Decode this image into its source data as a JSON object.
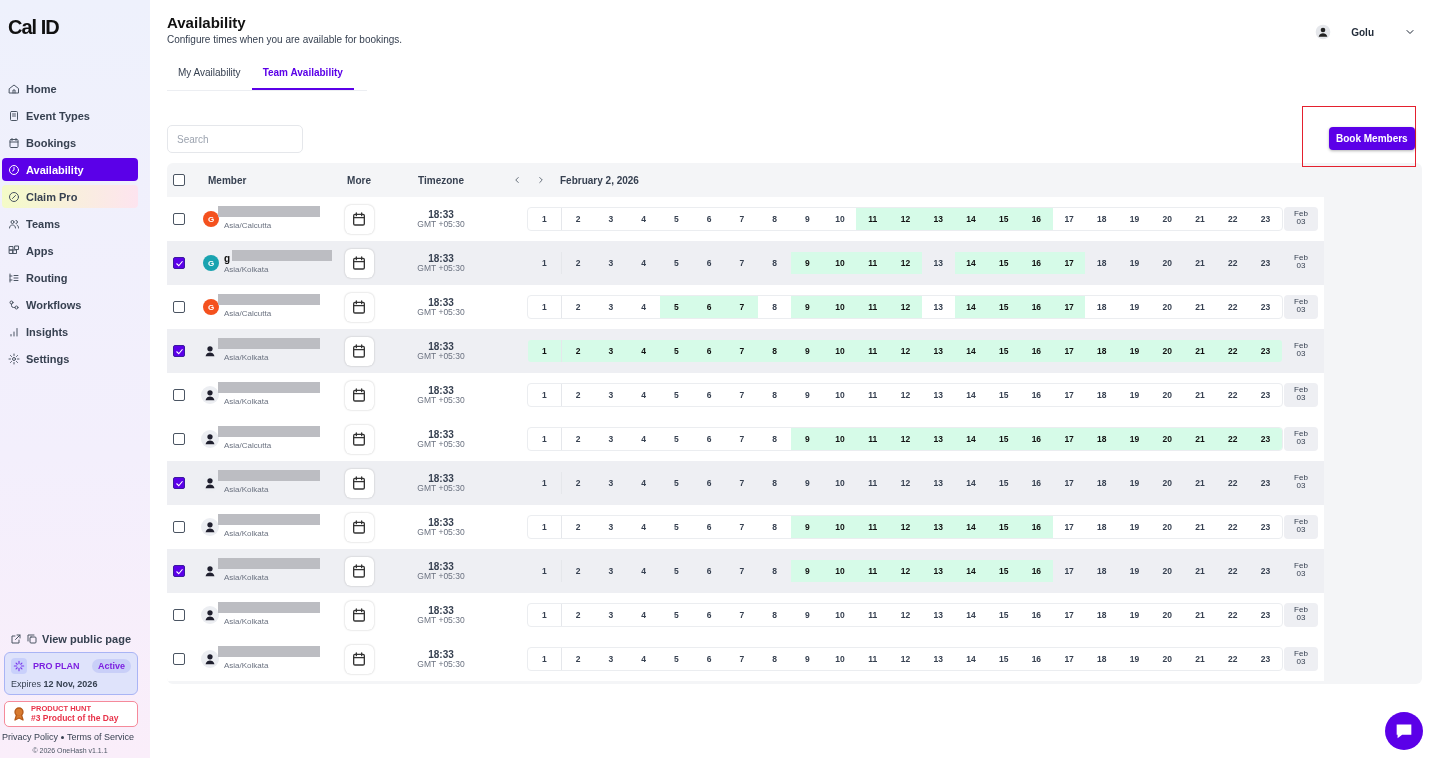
{
  "sidebar": {
    "logo": "Cal ID",
    "items": [
      {
        "label": "Home",
        "kind": "nav",
        "selected": false
      },
      {
        "label": "Event Types",
        "kind": "nav",
        "selected": false
      },
      {
        "label": "Bookings",
        "kind": "nav",
        "selected": false
      },
      {
        "label": "Availability",
        "kind": "nav",
        "selected": true
      },
      {
        "label": "Claim Pro",
        "kind": "promo",
        "selected": false
      },
      {
        "label": "Teams",
        "kind": "nav",
        "selected": false
      },
      {
        "label": "Apps",
        "kind": "nav",
        "selected": false
      },
      {
        "label": "Routing",
        "kind": "nav",
        "selected": false
      },
      {
        "label": "Workflows",
        "kind": "nav",
        "selected": false
      },
      {
        "label": "Insights",
        "kind": "nav",
        "selected": false
      },
      {
        "label": "Settings",
        "kind": "nav",
        "selected": false
      }
    ],
    "public_page": "View public page",
    "plan": {
      "name": "PRO PLAN",
      "badge": "Active",
      "expires_label": "Expires",
      "expires_date": "12 Nov, 2026"
    },
    "product_hunt": {
      "overline": "PRODUCT HUNT",
      "title": "#3 Product of the Day"
    },
    "footer_links": [
      "Privacy Policy",
      "Terms of Service"
    ],
    "copyright": "© 2026 OneHash v1.1.1"
  },
  "header": {
    "title": "Availability",
    "subtitle": "Configure times when you are available for bookings.",
    "user": "Golu"
  },
  "tabs": [
    {
      "label": "My Availability",
      "selected": false
    },
    {
      "label": "Team Availability",
      "selected": true
    }
  ],
  "search": {
    "placeholder": "Search"
  },
  "book_button": {
    "label": "Book Members",
    "highlighted": true
  },
  "table": {
    "columns": [
      "Member",
      "More",
      "Timezone"
    ],
    "date": "February 2, 2026",
    "all_checked": false,
    "rows": [
      {
        "checked": false,
        "avatar": {
          "kind": "letter",
          "letter": "G",
          "color": "#f4511e"
        },
        "redacted": true,
        "tz": "Asia/Calcutta",
        "time": "18:33",
        "offset": "GMT +05:30",
        "next": "Feb 03",
        "slots": [
          {
            "label": "1",
            "available": false
          },
          {
            "label": "2",
            "available": false
          },
          {
            "label": "3",
            "available": false
          },
          {
            "label": "4",
            "available": false
          },
          {
            "label": "5",
            "available": false
          },
          {
            "label": "6",
            "available": false
          },
          {
            "label": "7",
            "available": false
          },
          {
            "label": "8",
            "available": false
          },
          {
            "label": "9",
            "available": false
          },
          {
            "label": "10",
            "available": false
          },
          {
            "label": "11",
            "available": true
          },
          {
            "label": "12",
            "available": true
          },
          {
            "label": "13",
            "available": true
          },
          {
            "label": "14",
            "available": true
          },
          {
            "label": "15",
            "available": true
          },
          {
            "label": "16",
            "available": true
          },
          {
            "label": "17",
            "available": false
          },
          {
            "label": "18",
            "available": false
          },
          {
            "label": "19",
            "available": false
          },
          {
            "label": "20",
            "available": false
          },
          {
            "label": "21",
            "available": false
          },
          {
            "label": "22",
            "available": false
          },
          {
            "label": "23",
            "available": false
          }
        ]
      },
      {
        "checked": true,
        "avatar": {
          "kind": "letter",
          "letter": "G",
          "color": "#1aa3b0"
        },
        "name": "g",
        "redacted": true,
        "tz": "Asia/Kolkata",
        "time": "18:33",
        "offset": "GMT +05:30",
        "next": "Feb 03",
        "slots": [
          {
            "label": "1",
            "available": false
          },
          {
            "label": "2",
            "available": false
          },
          {
            "label": "3",
            "available": false
          },
          {
            "label": "4",
            "available": false
          },
          {
            "label": "5",
            "available": false
          },
          {
            "label": "6",
            "available": false
          },
          {
            "label": "7",
            "available": false
          },
          {
            "label": "8",
            "available": false
          },
          {
            "label": "9",
            "available": true
          },
          {
            "label": "10",
            "available": true
          },
          {
            "label": "11",
            "available": true
          },
          {
            "label": "12",
            "available": true
          },
          {
            "label": "13",
            "available": false
          },
          {
            "label": "14",
            "available": true
          },
          {
            "label": "15",
            "available": true
          },
          {
            "label": "16",
            "available": true
          },
          {
            "label": "17",
            "available": true
          },
          {
            "label": "18",
            "available": false
          },
          {
            "label": "19",
            "available": false
          },
          {
            "label": "20",
            "available": false
          },
          {
            "label": "21",
            "available": false
          },
          {
            "label": "22",
            "available": false
          },
          {
            "label": "23",
            "available": false
          }
        ]
      },
      {
        "checked": false,
        "avatar": {
          "kind": "letter",
          "letter": "G",
          "color": "#f4511e"
        },
        "redacted": true,
        "tz": "Asia/Calcutta",
        "time": "18:33",
        "offset": "GMT +05:30",
        "next": "Feb 03",
        "slots": [
          {
            "label": "1",
            "available": false
          },
          {
            "label": "2",
            "available": false
          },
          {
            "label": "3",
            "available": false
          },
          {
            "label": "4",
            "available": false
          },
          {
            "label": "5",
            "available": true
          },
          {
            "label": "6",
            "available": true
          },
          {
            "label": "7",
            "available": true
          },
          {
            "label": "8",
            "available": false
          },
          {
            "label": "9",
            "available": true
          },
          {
            "label": "10",
            "available": true
          },
          {
            "label": "11",
            "available": true
          },
          {
            "label": "12",
            "available": true
          },
          {
            "label": "13",
            "available": false
          },
          {
            "label": "14",
            "available": true
          },
          {
            "label": "15",
            "available": true
          },
          {
            "label": "16",
            "available": true
          },
          {
            "label": "17",
            "available": true
          },
          {
            "label": "18",
            "available": false
          },
          {
            "label": "19",
            "available": false
          },
          {
            "label": "20",
            "available": false
          },
          {
            "label": "21",
            "available": false
          },
          {
            "label": "22",
            "available": false
          },
          {
            "label": "23",
            "available": false
          }
        ]
      },
      {
        "checked": true,
        "avatar": {
          "kind": "person"
        },
        "redacted": true,
        "tz": "Asia/Kolkata",
        "time": "18:33",
        "offset": "GMT +05:30",
        "next": "Feb 03",
        "slots": [
          {
            "label": "1",
            "available": true
          },
          {
            "label": "2",
            "available": true
          },
          {
            "label": "3",
            "available": true
          },
          {
            "label": "4",
            "available": true
          },
          {
            "label": "5",
            "available": true
          },
          {
            "label": "6",
            "available": true
          },
          {
            "label": "7",
            "available": true
          },
          {
            "label": "8",
            "available": true
          },
          {
            "label": "9",
            "available": true
          },
          {
            "label": "10",
            "available": true
          },
          {
            "label": "11",
            "available": true
          },
          {
            "label": "12",
            "available": true
          },
          {
            "label": "13",
            "available": true
          },
          {
            "label": "14",
            "available": true
          },
          {
            "label": "15",
            "available": true
          },
          {
            "label": "16",
            "available": true
          },
          {
            "label": "17",
            "available": true
          },
          {
            "label": "18",
            "available": true
          },
          {
            "label": "19",
            "available": true
          },
          {
            "label": "20",
            "available": true
          },
          {
            "label": "21",
            "available": true
          },
          {
            "label": "22",
            "available": true
          },
          {
            "label": "23",
            "available": true
          }
        ]
      },
      {
        "checked": false,
        "avatar": {
          "kind": "person"
        },
        "redacted": true,
        "tz": "Asia/Kolkata",
        "time": "18:33",
        "offset": "GMT +05:30",
        "next": "Feb 03",
        "slots": [
          {
            "label": "1",
            "available": false
          },
          {
            "label": "2",
            "available": false
          },
          {
            "label": "3",
            "available": false
          },
          {
            "label": "4",
            "available": false
          },
          {
            "label": "5",
            "available": false
          },
          {
            "label": "6",
            "available": false
          },
          {
            "label": "7",
            "available": false
          },
          {
            "label": "8",
            "available": false
          },
          {
            "label": "9",
            "available": false
          },
          {
            "label": "10",
            "available": false
          },
          {
            "label": "11",
            "available": false
          },
          {
            "label": "12",
            "available": false
          },
          {
            "label": "13",
            "available": false
          },
          {
            "label": "14",
            "available": false
          },
          {
            "label": "15",
            "available": false
          },
          {
            "label": "16",
            "available": false
          },
          {
            "label": "17",
            "available": false
          },
          {
            "label": "18",
            "available": false
          },
          {
            "label": "19",
            "available": false
          },
          {
            "label": "20",
            "available": false
          },
          {
            "label": "21",
            "available": false
          },
          {
            "label": "22",
            "available": false
          },
          {
            "label": "23",
            "available": false
          }
        ]
      },
      {
        "checked": false,
        "avatar": {
          "kind": "person"
        },
        "redacted": true,
        "tz": "Asia/Calcutta",
        "time": "18:33",
        "offset": "GMT +05:30",
        "next": "Feb 03",
        "slots": [
          {
            "label": "1",
            "available": false
          },
          {
            "label": "2",
            "available": false
          },
          {
            "label": "3",
            "available": false
          },
          {
            "label": "4",
            "available": false
          },
          {
            "label": "5",
            "available": false
          },
          {
            "label": "6",
            "available": false
          },
          {
            "label": "7",
            "available": false
          },
          {
            "label": "8",
            "available": false
          },
          {
            "label": "9",
            "available": true
          },
          {
            "label": "10",
            "available": true
          },
          {
            "label": "11",
            "available": true
          },
          {
            "label": "12",
            "available": true
          },
          {
            "label": "13",
            "available": true
          },
          {
            "label": "14",
            "available": true
          },
          {
            "label": "15",
            "available": true
          },
          {
            "label": "16",
            "available": true
          },
          {
            "label": "17",
            "available": true
          },
          {
            "label": "18",
            "available": true
          },
          {
            "label": "19",
            "available": true
          },
          {
            "label": "20",
            "available": true
          },
          {
            "label": "21",
            "available": true
          },
          {
            "label": "22",
            "available": true
          },
          {
            "label": "23",
            "available": true
          }
        ]
      },
      {
        "checked": true,
        "avatar": {
          "kind": "person"
        },
        "redacted": true,
        "tz": "Asia/Kolkata",
        "time": "18:33",
        "offset": "GMT +05:30",
        "next": "Feb 03",
        "slots": [
          {
            "label": "1",
            "available": false
          },
          {
            "label": "2",
            "available": false
          },
          {
            "label": "3",
            "available": false
          },
          {
            "label": "4",
            "available": false
          },
          {
            "label": "5",
            "available": false
          },
          {
            "label": "6",
            "available": false
          },
          {
            "label": "7",
            "available": false
          },
          {
            "label": "8",
            "available": false
          },
          {
            "label": "9",
            "available": false
          },
          {
            "label": "10",
            "available": false
          },
          {
            "label": "11",
            "available": false
          },
          {
            "label": "12",
            "available": false
          },
          {
            "label": "13",
            "available": false
          },
          {
            "label": "14",
            "available": false
          },
          {
            "label": "15",
            "available": false
          },
          {
            "label": "16",
            "available": false
          },
          {
            "label": "17",
            "available": false
          },
          {
            "label": "18",
            "available": false
          },
          {
            "label": "19",
            "available": false
          },
          {
            "label": "20",
            "available": false
          },
          {
            "label": "21",
            "available": false
          },
          {
            "label": "22",
            "available": false
          },
          {
            "label": "23",
            "available": false
          }
        ]
      },
      {
        "checked": false,
        "avatar": {
          "kind": "person"
        },
        "redacted": true,
        "tz": "Asia/Kolkata",
        "time": "18:33",
        "offset": "GMT +05:30",
        "next": "Feb 03",
        "slots": [
          {
            "label": "1",
            "available": false
          },
          {
            "label": "2",
            "available": false
          },
          {
            "label": "3",
            "available": false
          },
          {
            "label": "4",
            "available": false
          },
          {
            "label": "5",
            "available": false
          },
          {
            "label": "6",
            "available": false
          },
          {
            "label": "7",
            "available": false
          },
          {
            "label": "8",
            "available": false
          },
          {
            "label": "9",
            "available": true
          },
          {
            "label": "10",
            "available": true
          },
          {
            "label": "11",
            "available": true
          },
          {
            "label": "12",
            "available": true
          },
          {
            "label": "13",
            "available": true
          },
          {
            "label": "14",
            "available": true
          },
          {
            "label": "15",
            "available": true
          },
          {
            "label": "16",
            "available": true
          },
          {
            "label": "17",
            "available": false
          },
          {
            "label": "18",
            "available": false
          },
          {
            "label": "19",
            "available": false
          },
          {
            "label": "20",
            "available": false
          },
          {
            "label": "21",
            "available": false
          },
          {
            "label": "22",
            "available": false
          },
          {
            "label": "23",
            "available": false
          }
        ]
      },
      {
        "checked": true,
        "avatar": {
          "kind": "person"
        },
        "redacted": true,
        "tz": "Asia/Kolkata",
        "time": "18:33",
        "offset": "GMT +05:30",
        "next": "Feb 03",
        "slots": [
          {
            "label": "1",
            "available": false
          },
          {
            "label": "2",
            "available": false
          },
          {
            "label": "3",
            "available": false
          },
          {
            "label": "4",
            "available": false
          },
          {
            "label": "5",
            "available": false
          },
          {
            "label": "6",
            "available": false
          },
          {
            "label": "7",
            "available": false
          },
          {
            "label": "8",
            "available": false
          },
          {
            "label": "9",
            "available": true
          },
          {
            "label": "10",
            "available": true
          },
          {
            "label": "11",
            "available": true
          },
          {
            "label": "12",
            "available": true
          },
          {
            "label": "13",
            "available": true
          },
          {
            "label": "14",
            "available": true
          },
          {
            "label": "15",
            "available": true
          },
          {
            "label": "16",
            "available": true
          },
          {
            "label": "17",
            "available": false
          },
          {
            "label": "18",
            "available": false
          },
          {
            "label": "19",
            "available": false
          },
          {
            "label": "20",
            "available": false
          },
          {
            "label": "21",
            "available": false
          },
          {
            "label": "22",
            "available": false
          },
          {
            "label": "23",
            "available": false
          }
        ]
      },
      {
        "checked": false,
        "avatar": {
          "kind": "person"
        },
        "redacted": true,
        "tz": "Asia/Kolkata",
        "time": "18:33",
        "offset": "GMT +05:30",
        "next": "Feb 03",
        "slots": [
          {
            "label": "1",
            "available": false
          },
          {
            "label": "2",
            "available": false
          },
          {
            "label": "3",
            "available": false
          },
          {
            "label": "4",
            "available": false
          },
          {
            "label": "5",
            "available": false
          },
          {
            "label": "6",
            "available": false
          },
          {
            "label": "7",
            "available": false
          },
          {
            "label": "8",
            "available": false
          },
          {
            "label": "9",
            "available": false
          },
          {
            "label": "10",
            "available": false
          },
          {
            "label": "11",
            "available": false
          },
          {
            "label": "12",
            "available": false
          },
          {
            "label": "13",
            "available": false
          },
          {
            "label": "14",
            "available": false
          },
          {
            "label": "15",
            "available": false
          },
          {
            "label": "16",
            "available": false
          },
          {
            "label": "17",
            "available": false
          },
          {
            "label": "18",
            "available": false
          },
          {
            "label": "19",
            "available": false
          },
          {
            "label": "20",
            "available": false
          },
          {
            "label": "21",
            "available": false
          },
          {
            "label": "22",
            "available": false
          },
          {
            "label": "23",
            "available": false
          }
        ]
      },
      {
        "checked": false,
        "avatar": {
          "kind": "person"
        },
        "redacted": true,
        "tz": "Asia/Kolkata",
        "time": "18:33",
        "offset": "GMT +05:30",
        "next": "Feb 03",
        "slots": [
          {
            "label": "1",
            "available": false
          },
          {
            "label": "2",
            "available": false
          },
          {
            "label": "3",
            "available": false
          },
          {
            "label": "4",
            "available": false
          },
          {
            "label": "5",
            "available": false
          },
          {
            "label": "6",
            "available": false
          },
          {
            "label": "7",
            "available": false
          },
          {
            "label": "8",
            "available": false
          },
          {
            "label": "9",
            "available": false
          },
          {
            "label": "10",
            "available": false
          },
          {
            "label": "11",
            "available": false
          },
          {
            "label": "12",
            "available": false
          },
          {
            "label": "13",
            "available": false
          },
          {
            "label": "14",
            "available": false
          },
          {
            "label": "15",
            "available": false
          },
          {
            "label": "16",
            "available": false
          },
          {
            "label": "17",
            "available": false
          },
          {
            "label": "18",
            "available": false
          },
          {
            "label": "19",
            "available": false
          },
          {
            "label": "20",
            "available": false
          },
          {
            "label": "21",
            "available": false
          },
          {
            "label": "22",
            "available": false
          },
          {
            "label": "23",
            "available": false
          }
        ]
      }
    ]
  }
}
